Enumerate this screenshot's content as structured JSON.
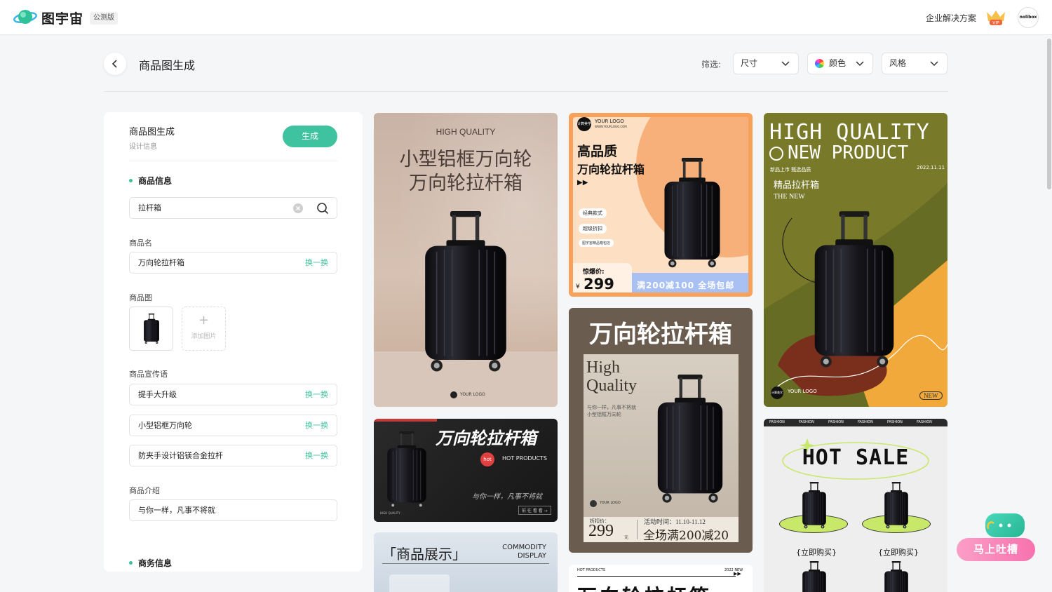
{
  "topbar": {
    "brand": "图宇宙",
    "beta_badge": "公测版",
    "enterprise_link": "企业解决方案",
    "vip_label": "VIP",
    "avatar_text": "nolibox"
  },
  "header": {
    "title": "商品图生成",
    "filter_label": "筛选:",
    "filters": {
      "size": "尺寸",
      "color": "颜色",
      "style": "风格"
    }
  },
  "panel": {
    "title": "商品图生成",
    "subtitle": "设计信息",
    "generate_label": "生成",
    "product_info_heading": "商品信息",
    "search_value": "拉杆箱",
    "name_label": "商品名",
    "name_value": "万向轮拉杆箱",
    "swap_label": "换一换",
    "image_label": "商品图",
    "add_image_label": "添加图片",
    "slogan_label": "商品宣传语",
    "slogans": [
      "提手大升级",
      "小型铝框万向轮",
      "防夹手设计铝镁合金拉杆"
    ],
    "intro_label": "商品介绍",
    "intro_value": "与你一样，凡事不将就",
    "business_heading": "商务信息"
  },
  "cards": {
    "c1": {
      "eyebrow": "HIGH QUALITY",
      "line1": "小型铝框万向轮",
      "line2": "万向轮拉杆箱",
      "logo": "YOUR LOGO"
    },
    "c2": {
      "title": "万向轮拉杆箱",
      "tag": "HOT PRODUCTS",
      "badge": "hot",
      "slogan": "与你一样，凡事不将就",
      "foot": "HIGH QUALITY",
      "btn": "前 往 看 看 →"
    },
    "c3": {
      "title": "「商品展示」",
      "eng1": "COMMODITY",
      "eng2": "DISPLAY"
    },
    "c4": {
      "logo_badge": "计算美学",
      "logo": "YOUR LOGO",
      "logo_url": "WWW.YOURLOGO.COM",
      "headline1": "高品质",
      "headline2": "万向轮拉杆箱",
      "arrows": "▶▶",
      "tags": [
        "经典款式",
        "超级折扣",
        "图宇宙精品箱包店"
      ],
      "price_label": "惊爆价:",
      "currency": "¥",
      "price": "299",
      "promo": "满200减100 全场包邮"
    },
    "c5": {
      "title": "万向轮拉杆箱",
      "hq1": "High",
      "hq2": "Quality",
      "desc1": "与你一样，凡事不将就",
      "desc2": "小型铝框万向轮",
      "logo": "YOUR LOGO",
      "price_label": "折扣价：",
      "price": "299",
      "unit": "元",
      "time_label": "活动时间：11.10-11.12",
      "promo": "全场满200减20"
    },
    "c6": {
      "tag": "HOT PRODUCTS",
      "year": "2022 NEW",
      "arrows": "▶▶",
      "title": "万向轮拉杆箱"
    },
    "c7": {
      "line1": "HIGH QUALITY",
      "line2": "NEW PRODUCT",
      "sub": "新品上市  甄选品质",
      "date": "2022.11.11",
      "script": "精品拉杆箱",
      "the_new": "THE NEW",
      "logo": "YOUR LOGO",
      "badge": "NEW",
      "logo_badge": "计算美学"
    },
    "c8": {
      "ticker": [
        "FASHION",
        "FASHION",
        "FASHION",
        "FASHION",
        "FASHION",
        "FASHION"
      ],
      "title": "HOT SALE",
      "buy_left": "{立即购买}",
      "buy_right": "{立即购买}"
    }
  },
  "feedback": {
    "label": "马上吐槽"
  },
  "colors": {
    "accent": "#3fc29f",
    "feedback": "#f772ae"
  }
}
